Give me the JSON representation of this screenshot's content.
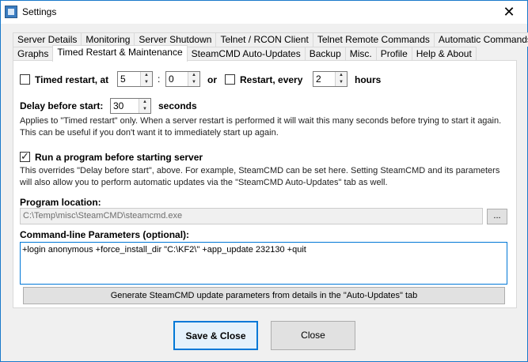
{
  "window": {
    "title": "Settings",
    "close_glyph": "✕",
    "app_icon": "app-icon"
  },
  "tabs": {
    "row1": [
      "Server Details",
      "Monitoring",
      "Server Shutdown",
      "Telnet / RCON Client",
      "Telnet Remote Commands",
      "Automatic Commands"
    ],
    "row2": [
      "Graphs",
      "Timed Restart & Maintenance",
      "SteamCMD Auto-Updates",
      "Backup",
      "Misc.",
      "Profile",
      "Help & About"
    ],
    "active": "Timed Restart & Maintenance"
  },
  "timed_restart": {
    "label": "Timed restart, at",
    "checked": false,
    "hour": "5",
    "separator": ":",
    "minute": "0",
    "or": "or"
  },
  "restart_every": {
    "label": "Restart, every",
    "checked": false,
    "value": "2",
    "unit": "hours"
  },
  "delay": {
    "label": "Delay before start:",
    "value": "30",
    "unit": "seconds",
    "help": "Applies to \"Timed restart\" only. When a server restart is performed it will wait this many seconds before trying to start it again. This can be useful if you don't want it to immediately start up again."
  },
  "run_program": {
    "label": "Run a program before starting server",
    "checked": true,
    "help": "This overrides \"Delay before start\", above. For example, SteamCMD can be set here. Setting SteamCMD and its parameters will also allow you to perform automatic updates via the \"SteamCMD Auto-Updates\" tab as well."
  },
  "program_location": {
    "label": "Program location:",
    "value": "C:\\Temp\\misc\\SteamCMD\\steamcmd.exe",
    "browse_label": "..."
  },
  "params": {
    "label": "Command-line Parameters (optional):",
    "value": "+login anonymous +force_install_dir \"C:\\KF2\\\" +app_update 232130 +quit"
  },
  "generate_button": "Generate SteamCMD update parameters from details in the \"Auto-Updates\" tab",
  "footer": {
    "save_label": "Save & Close",
    "close_label": "Close"
  }
}
